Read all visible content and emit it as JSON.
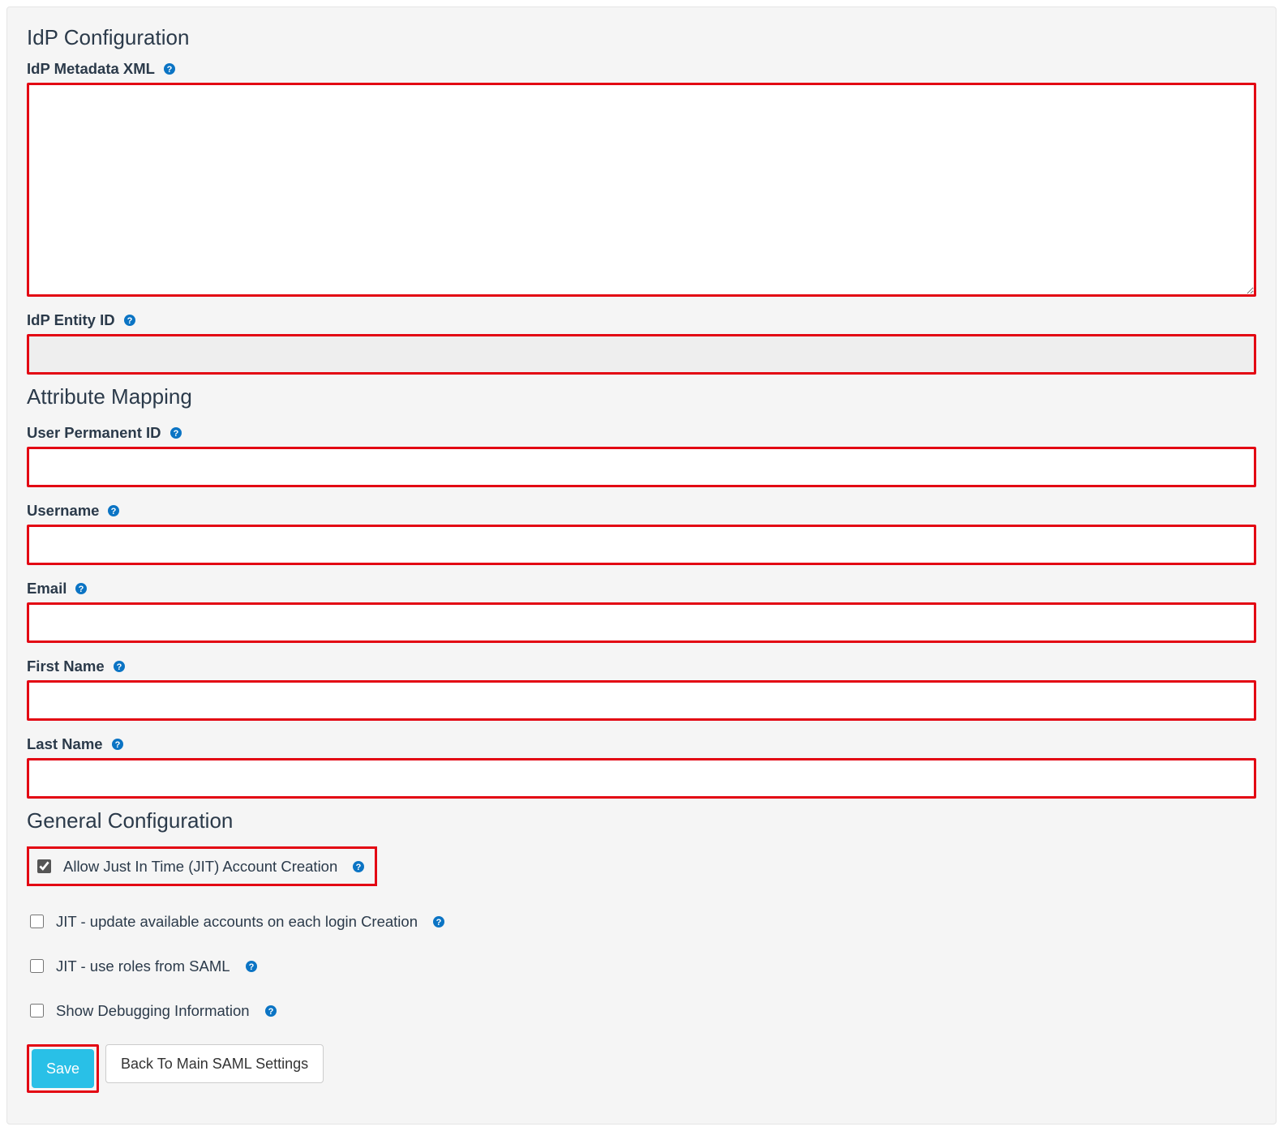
{
  "sections": {
    "idp": {
      "title": "IdP Configuration",
      "metadata_label": "IdP Metadata XML",
      "metadata_value": "",
      "entity_label": "IdP Entity ID",
      "entity_value": ""
    },
    "attr": {
      "title": "Attribute Mapping",
      "user_permanent_id_label": "User Permanent ID",
      "user_permanent_id_value": "",
      "username_label": "Username",
      "username_value": "",
      "email_label": "Email",
      "email_value": "",
      "first_name_label": "First Name",
      "first_name_value": "",
      "last_name_label": "Last Name",
      "last_name_value": ""
    },
    "general": {
      "title": "General Configuration",
      "jit_create_label": "Allow Just In Time (JIT) Account Creation",
      "jit_create_checked": true,
      "jit_update_label": "JIT - update available accounts on each login Creation",
      "jit_update_checked": false,
      "jit_roles_label": "JIT - use roles from SAML",
      "jit_roles_checked": false,
      "debug_label": "Show Debugging Information",
      "debug_checked": false
    }
  },
  "buttons": {
    "save": "Save",
    "back": "Back To Main SAML Settings"
  },
  "icons": {
    "help": "question-circle-icon"
  },
  "colors": {
    "highlight_border": "#e30613",
    "primary_button": "#29c0e7",
    "help_icon": "#0b74c4"
  }
}
